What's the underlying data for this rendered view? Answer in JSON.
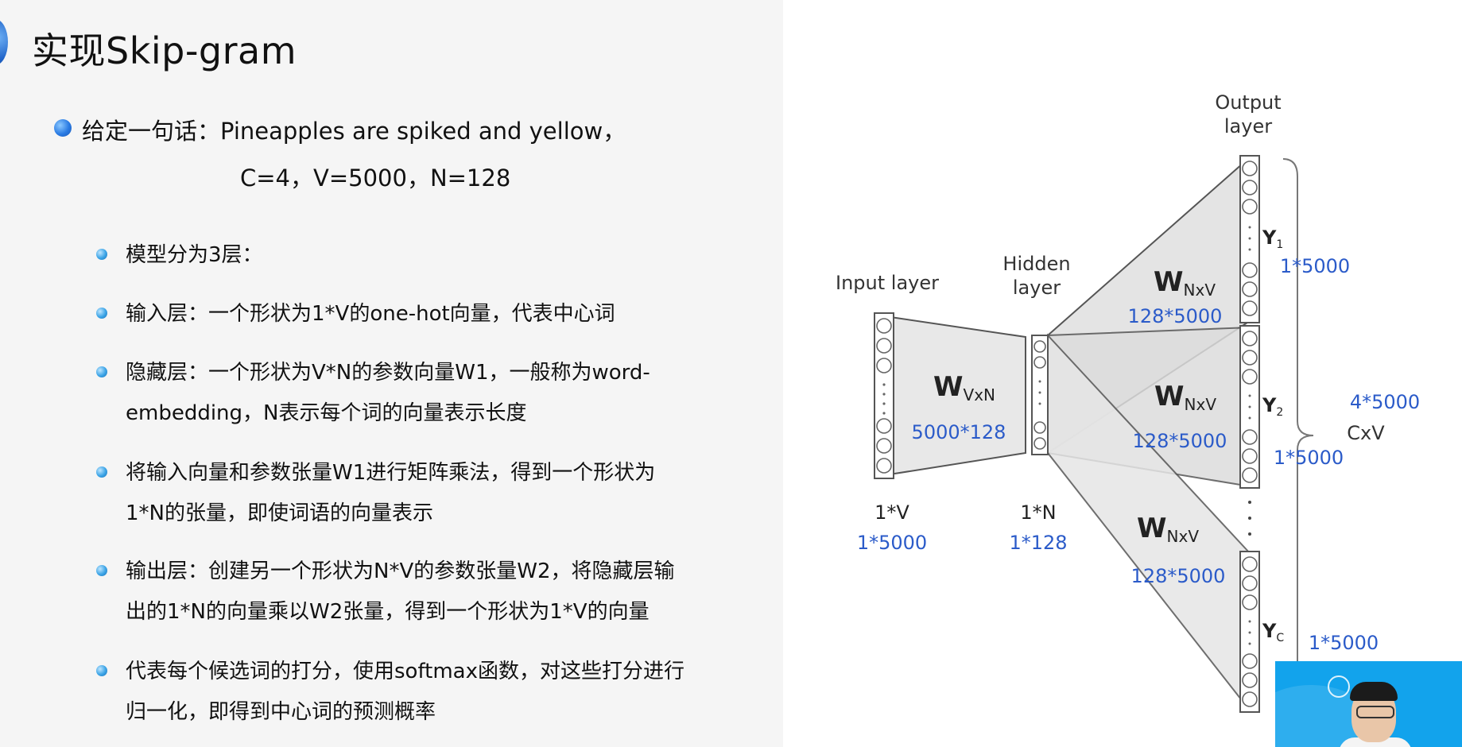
{
  "title": "实现Skip-gram",
  "main_bullet": {
    "line1": "给定一句话：Pineapples are spiked and yellow，",
    "line2": "C=4，V=5000，N=128"
  },
  "sub_bullets": [
    {
      "lines": [
        "模型分为3层："
      ]
    },
    {
      "lines": [
        "输入层：一个形状为1*V的one-hot向量，代表中心词"
      ]
    },
    {
      "lines": [
        "隐藏层：一个形状为V*N的参数向量W1，一般称为word-",
        "embedding，N表示每个词的向量表示长度"
      ]
    },
    {
      "lines": [
        "将输入向量和参数张量W1进行矩阵乘法，得到一个形状为",
        "1*N的张量，即使词语的向量表示"
      ]
    },
    {
      "lines": [
        "输出层：创建另一个形状为N*V的参数张量W2，将隐藏层输",
        "出的1*N的向量乘以W2张量，得到一个形状为1*V的向量"
      ]
    },
    {
      "lines": [
        "代表每个候选词的打分，使用softmax函数，对这些打分进行",
        "归一化，即得到中心词的预测概率"
      ]
    }
  ],
  "diagram": {
    "input_layer_label": "Input layer",
    "hidden_layer_label": [
      "Hidden",
      "layer"
    ],
    "output_layer_label": [
      "Output",
      "layer"
    ],
    "w_in": {
      "main": "W",
      "sub": "VxN",
      "dims": "5000*128"
    },
    "w_out": [
      {
        "main": "W",
        "sub": "NxV",
        "dims": "128*5000"
      },
      {
        "main": "W",
        "sub": "NxV",
        "dims": "128*5000"
      },
      {
        "main": "W",
        "sub": "NxV",
        "dims": "128*5000"
      }
    ],
    "input_shape": "1*V",
    "input_dims": "1*5000",
    "hidden_shape": "1*N",
    "hidden_dims": "1*128",
    "outputs": [
      {
        "main": "Y",
        "sub": "1",
        "dims": "1*5000"
      },
      {
        "main": "Y",
        "sub": "2",
        "dims": "1*5000"
      },
      {
        "main": "Y",
        "sub": "C",
        "dims": "1*5000"
      }
    ],
    "total_dims": "4*5000",
    "total_label": "CxV",
    "colors": {
      "blue": "#2b5bc9",
      "trap_fill": "#e8e8e8",
      "stroke": "#555555"
    }
  }
}
